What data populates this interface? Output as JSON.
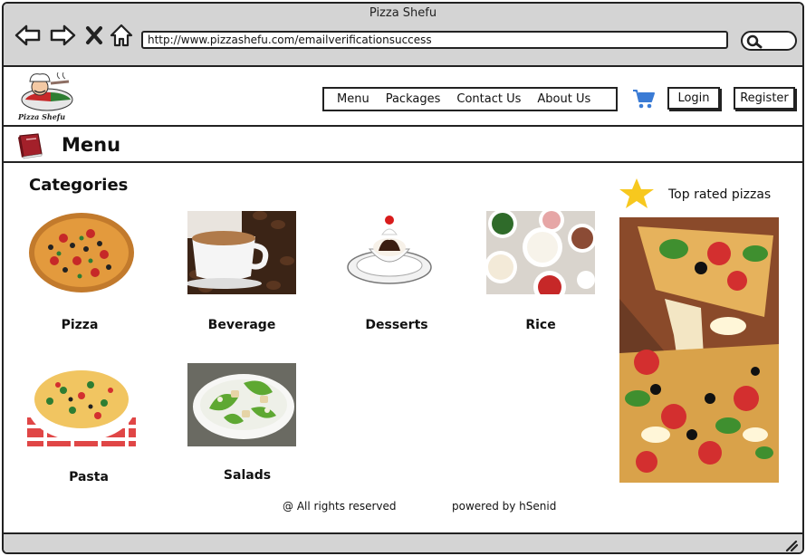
{
  "window": {
    "title": "Pizza Shefu"
  },
  "address_bar": {
    "url": "http://www.pizzashefu.com/emailverificationsuccess"
  },
  "logo": {
    "text": "Pizza Shefu"
  },
  "nav": {
    "items": [
      "Menu",
      "Packages",
      "Contact Us",
      "About Us"
    ],
    "login": "Login",
    "register": "Register"
  },
  "page": {
    "title": "Menu"
  },
  "categories": {
    "heading": "Categories",
    "items": [
      {
        "label": "Pizza",
        "icon": "pizza-image"
      },
      {
        "label": "Beverage",
        "icon": "coffee-image"
      },
      {
        "label": "Desserts",
        "icon": "dessert-image"
      },
      {
        "label": "Rice",
        "icon": "rice-image"
      },
      {
        "label": "Pasta",
        "icon": "pasta-image"
      },
      {
        "label": "Salads",
        "icon": "salad-image"
      }
    ]
  },
  "sidebar": {
    "top_rated_label": "Top rated pizzas"
  },
  "footer": {
    "rights": "@ All rights reserved",
    "powered": "powered by hSenid"
  },
  "colors": {
    "chrome": "#d4d4d4",
    "cart": "#3a7bd5",
    "star": "#f7c81e",
    "book": "#a3202a"
  }
}
